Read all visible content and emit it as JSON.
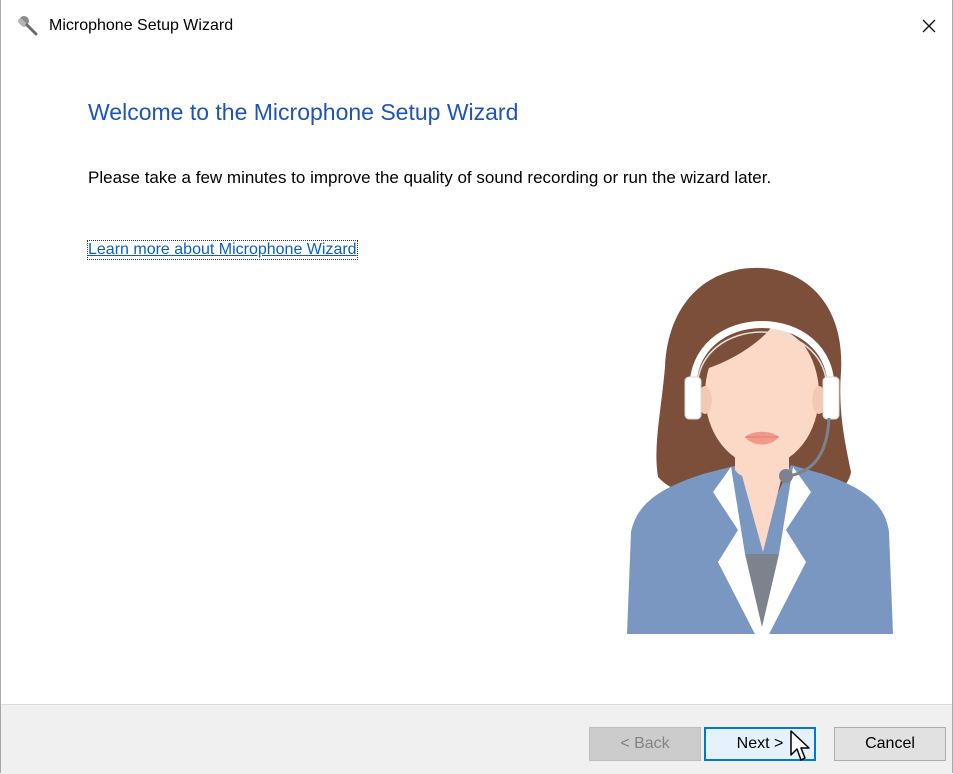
{
  "window": {
    "title": "Microphone Setup Wizard",
    "icon": "microphone-icon",
    "close_icon": "close-icon"
  },
  "page": {
    "heading": "Welcome to the Microphone Setup Wizard",
    "description": "Please take a few minutes to improve the quality of sound recording or run the wizard later.",
    "link_text": "Learn more about Microphone Wizard",
    "illustration": "headset-operator-illustration"
  },
  "buttons": {
    "back": {
      "label": "< Back",
      "enabled": false
    },
    "next": {
      "label": "Next >",
      "enabled": true,
      "focused": true
    },
    "cancel": {
      "label": "Cancel",
      "enabled": true
    }
  },
  "colors": {
    "heading": "#1e55b3",
    "link": "#0b5fc2",
    "footer_bg": "#f0f0f0",
    "focus_border": "#0078d7"
  }
}
